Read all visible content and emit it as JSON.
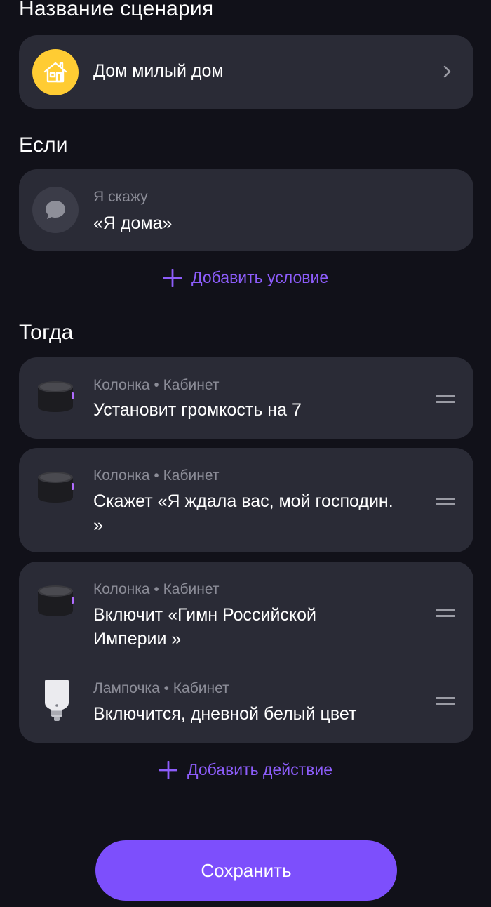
{
  "header": {
    "title": "Название сценария"
  },
  "scenario_name": {
    "value": "Дом милый дом",
    "icon": "house-icon",
    "icon_bg": "#ffcc33"
  },
  "if_section": {
    "title": "Если",
    "condition": {
      "label": "Я скажу",
      "value": "«Я дома»",
      "icon": "speech-bubble-icon"
    },
    "add_label": "Добавить условие"
  },
  "then_section": {
    "title": "Тогда",
    "actions": [
      {
        "device": "Колонка",
        "room": "Кабинет",
        "sep": " • ",
        "text": "Установит громкость на 7",
        "icon": "speaker-icon"
      },
      {
        "device": "Колонка",
        "room": "Кабинет",
        "sep": " • ",
        "text_line1": "Скажет «Я ждала вас, мой господин.",
        "text_line2": "»",
        "icon": "speaker-icon"
      },
      {
        "device": "Колонка",
        "room": "Кабинет",
        "sep": " • ",
        "text_line1": "Включит «Гимн Российской",
        "text_line2": "Империи »",
        "icon": "speaker-icon"
      },
      {
        "device": "Лампочка",
        "room": "Кабинет",
        "sep": " • ",
        "text": "Включится, дневной белый цвет",
        "icon": "light-bulb-icon"
      }
    ],
    "add_label": "Добавить действие"
  },
  "save_button": {
    "label": "Сохранить",
    "color": "#7d4ffc"
  },
  "colors": {
    "background": "#111119",
    "card": "#2a2b36",
    "accent": "#8d5dfb",
    "muted_text": "#8b8c97"
  }
}
